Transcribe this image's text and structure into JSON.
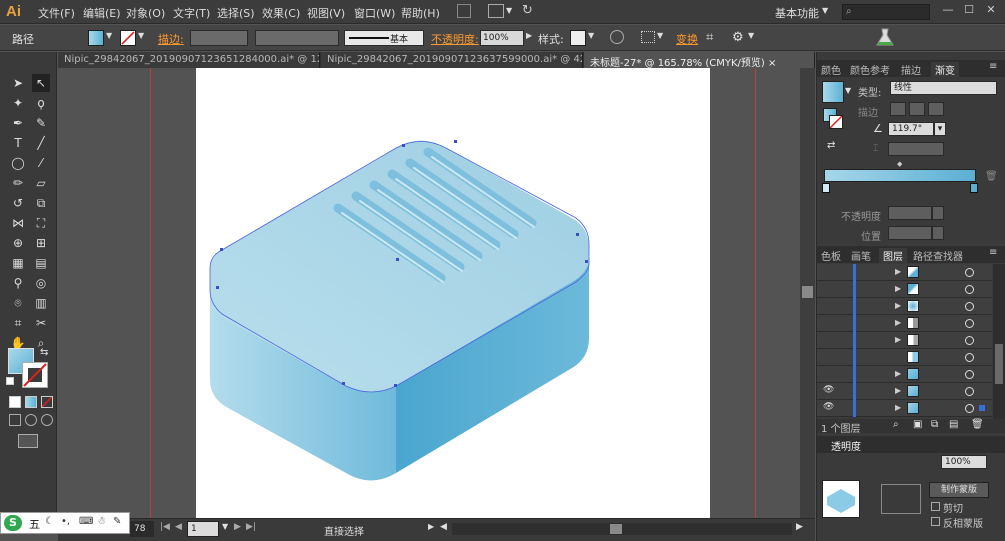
{
  "app": {
    "logo": "Ai"
  },
  "menu": [
    "文件(F)",
    "编辑(E)",
    "对象(O)",
    "文字(T)",
    "选择(S)",
    "效果(C)",
    "视图(V)",
    "窗口(W)",
    "帮助(H)"
  ],
  "workspace": {
    "label": "基本功能"
  },
  "control": {
    "object_type": "路径",
    "stroke_label": "描边:",
    "brush_label": "基本",
    "opacity_label": "不透明度:",
    "opacity_value": "100%",
    "style_label": "样式:",
    "transform_label": "变换"
  },
  "tabs": [
    {
      "label": "Nipic_29842067_20190907123651284000.ai* @ 12..."
    },
    {
      "label": "Nipic_29842067_20190907123637599000.ai* @ 42..."
    },
    {
      "label": "未标题-27* @ 165.78% (CMYK/预览)"
    }
  ],
  "gradient_panel": {
    "tabs": [
      "颜色",
      "颜色参考",
      "描边",
      "渐变"
    ],
    "type_label": "类型:",
    "type_value": "线性",
    "stroke_label": "描边",
    "angle_value": "119.7°",
    "opacity_label": "不透明度",
    "position_label": "位置"
  },
  "layers_panel": {
    "tabs": [
      "色板",
      "画笔",
      "图层",
      "路径查找器"
    ],
    "footer_count": "1 个图层"
  },
  "transparency_panel": {
    "tab": "透明度",
    "opacity_value": "100%",
    "make_mask": "制作蒙版",
    "clip": "剪切",
    "invert": "反相蒙版"
  },
  "status": {
    "zoom": "78",
    "page": "1",
    "tool_name": "直接选择"
  },
  "ime": {
    "label": "五"
  },
  "colors": {
    "top_face": "#a6d4e6",
    "front_left": "#8ccbe6",
    "front_right": "#5cb1d4",
    "slot": "#7cbfdc",
    "anchor": "#3a4fc8"
  }
}
